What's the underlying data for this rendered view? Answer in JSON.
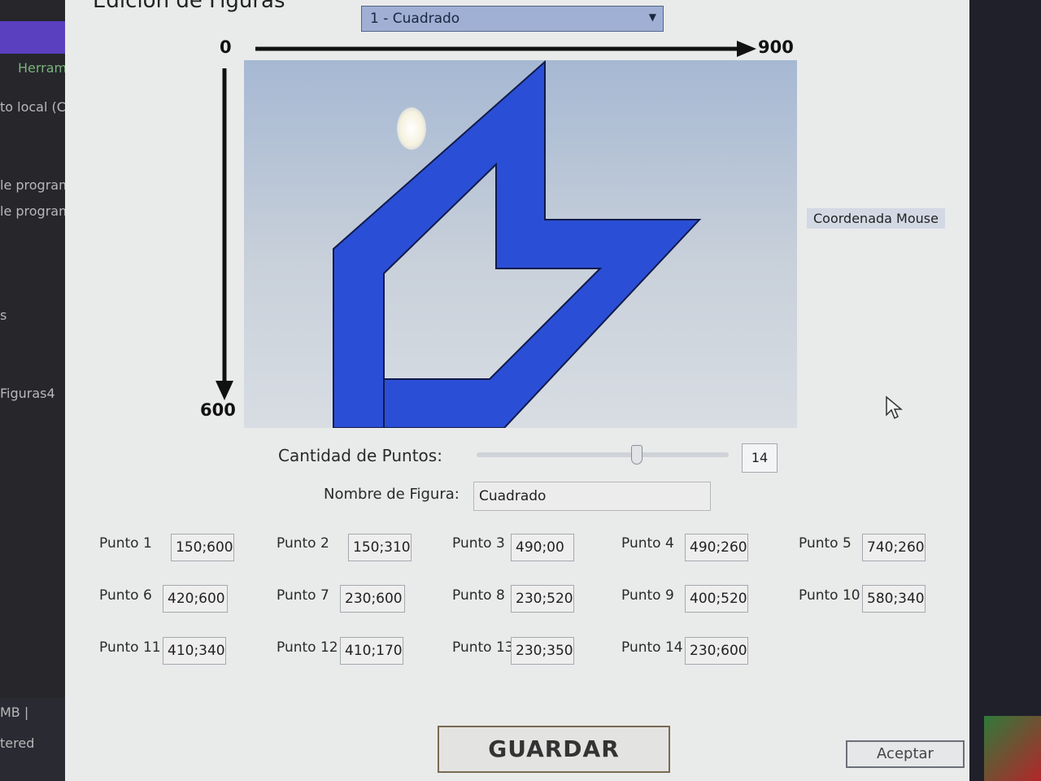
{
  "window": {
    "title": "Edición de Figuras"
  },
  "background_app": {
    "items": [
      "Herramie",
      "to local (C:",
      "le program",
      "le program",
      "s",
      "Figuras4",
      "MB  |",
      "tered"
    ]
  },
  "shape_select": {
    "value": "1 - Cuadrado"
  },
  "axes": {
    "x_start": "0",
    "x_end": "900",
    "y_end": "600"
  },
  "coord_mouse": "Coordenada Mouse",
  "point_count": {
    "label": "Cantidad de Puntos:",
    "value": "14",
    "level": 14
  },
  "figure_name": {
    "label": "Nombre de Figura:",
    "value": "Cuadrado"
  },
  "points": [
    {
      "label": "Punto 1",
      "value": "150;600"
    },
    {
      "label": "Punto 2",
      "value": "150;310"
    },
    {
      "label": "Punto 3",
      "value": "490;00"
    },
    {
      "label": "Punto 4",
      "value": "490;260"
    },
    {
      "label": "Punto 5",
      "value": "740;260"
    },
    {
      "label": "Punto 6",
      "value": "420;600"
    },
    {
      "label": "Punto 7",
      "value": "230;600"
    },
    {
      "label": "Punto 8",
      "value": "230;520"
    },
    {
      "label": "Punto 9",
      "value": "400;520"
    },
    {
      "label": "Punto 10",
      "value": "580;340"
    },
    {
      "label": "Punto 11",
      "value": "410;340"
    },
    {
      "label": "Punto 12",
      "value": "410;170"
    },
    {
      "label": "Punto 13",
      "value": "230;350"
    },
    {
      "label": "Punto 14",
      "value": "230;600"
    }
  ],
  "buttons": {
    "guardar": "GUARDAR",
    "aceptar": "Aceptar"
  },
  "colors": {
    "shape_fill": "#2a4fd6",
    "shape_stroke": "#101a4a",
    "select_bg": "#9fb0d4"
  },
  "icons": [
    "chevron-down-icon",
    "mouse-cursor-icon",
    "x-axis-arrow-icon",
    "y-axis-arrow-icon"
  ]
}
